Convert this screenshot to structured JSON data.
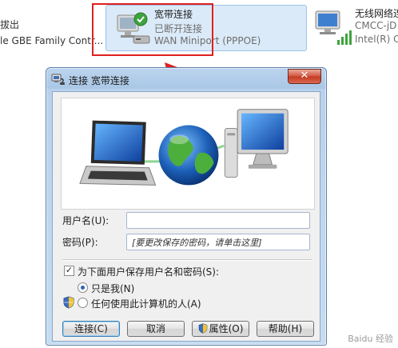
{
  "connections": {
    "left_item": {
      "line1": "拔出",
      "line2": "le GBE Family Contr..."
    },
    "selected": {
      "name": "宽带连接",
      "status": "已断开连接",
      "device": "WAN Miniport (PPPOE)"
    },
    "wifi": {
      "name": "无线网络连",
      "line2": "CMCC-jD",
      "line3": "Intel(R) C"
    }
  },
  "dialog": {
    "title": "连接 宽带连接",
    "close_symbol": "✕",
    "username_label": "用户名(U):",
    "username_value": "",
    "password_label": "密码(P):",
    "password_placeholder": "[要更改保存的密码，请单击这里]",
    "save_credentials_label": "为下面用户保存用户名和密码(S):",
    "save_credentials_checked": true,
    "radio_only_me_label": "只是我(N)",
    "radio_anyone_label": "任何使用此计算机的人(A)",
    "radio_selected": "only_me",
    "buttons": {
      "connect": "连接(C)",
      "cancel": "取消",
      "properties": "属性(O)",
      "help": "帮助(H)"
    }
  },
  "icons": {
    "selected_connection": "broadband-connection-icon",
    "wifi_connection": "wireless-network-icon",
    "title": "dialup-icon",
    "shield": "uac-shield-icon",
    "arrow": "red-arrow-annotation"
  },
  "colors": {
    "highlight": "#e02020",
    "selection": "#dbeaf8",
    "close_button": "#c23a20"
  },
  "watermark": "Baidu 经验"
}
